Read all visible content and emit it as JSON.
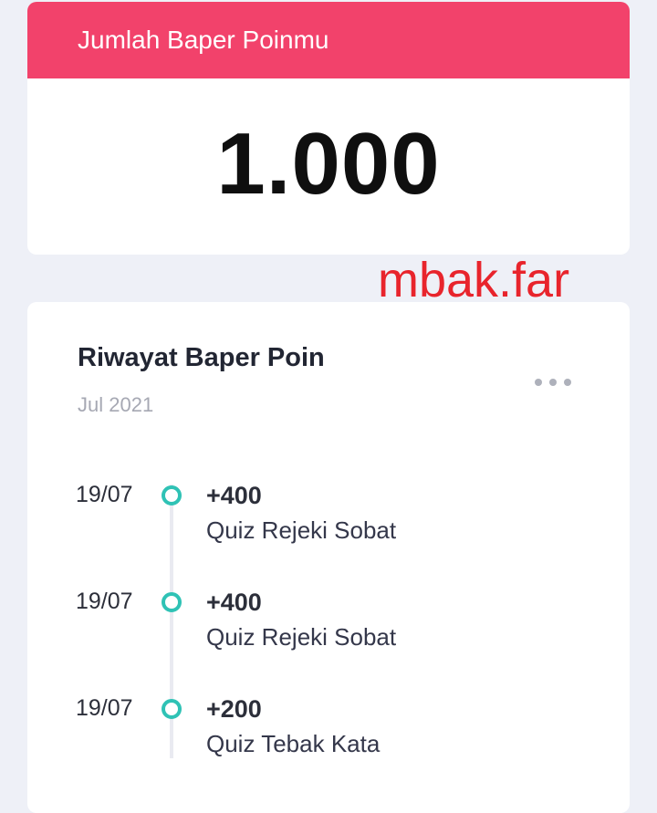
{
  "points_card": {
    "title": "Jumlah Baper Poinmu",
    "total": "1.000"
  },
  "watermark": "mbak.far",
  "history": {
    "title": "Riwayat Baper Poin",
    "month": "Jul 2021",
    "more_icon": "more-horizontal-icon",
    "entries": [
      {
        "date": "19/07",
        "points": "+400",
        "description": "Quiz Rejeki Sobat"
      },
      {
        "date": "19/07",
        "points": "+400",
        "description": "Quiz Rejeki Sobat"
      },
      {
        "date": "19/07",
        "points": "+200",
        "description": "Quiz Tebak Kata"
      }
    ]
  },
  "colors": {
    "header": "#f2426b",
    "timeline_dot": "#2fc2b5",
    "watermark": "#e8242c",
    "background": "#eef0f7"
  }
}
